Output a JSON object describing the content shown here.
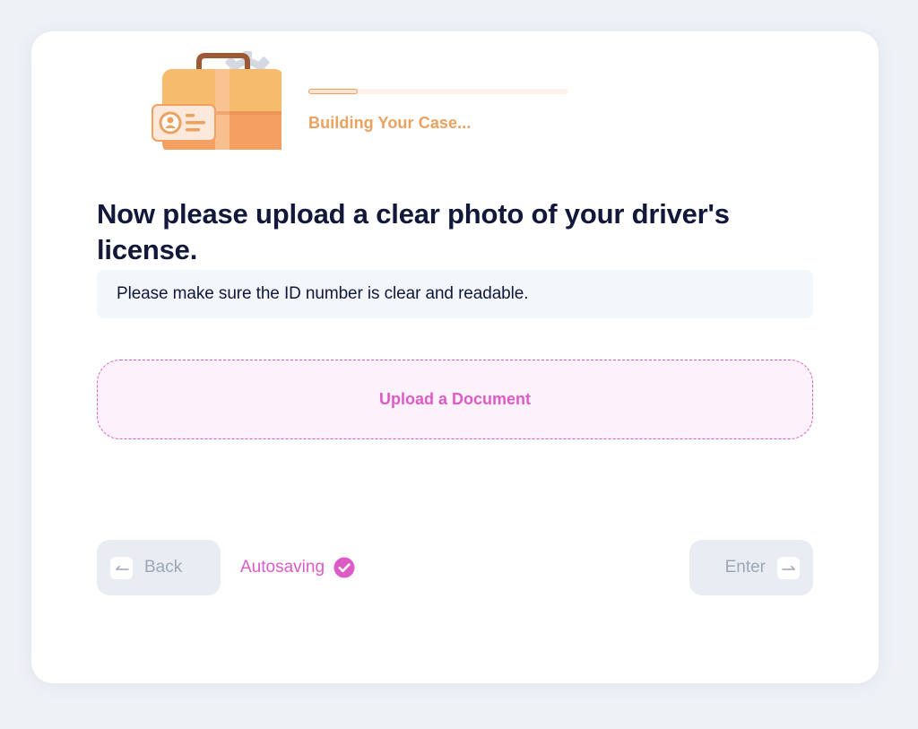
{
  "progress": {
    "label": "Building Your Case...",
    "fraction": 0.19
  },
  "question": {
    "title": "Now please upload a clear photo of your driver's license.",
    "hint": "Please make sure the ID number is clear and readable."
  },
  "upload": {
    "label": "Upload a Document"
  },
  "footer": {
    "back_label": "Back",
    "autosave_label": "Autosaving",
    "enter_label": "Enter"
  },
  "icons": {
    "illustration": "briefcase-id-gear-illustration",
    "back": "arrow-left-icon",
    "enter": "arrow-right-icon",
    "autosave": "check-circle-icon"
  },
  "colors": {
    "accent_orange": "#eda15f",
    "accent_pink": "#dd5bc5",
    "heading": "#11183a",
    "page_background": "#eef1f6"
  }
}
